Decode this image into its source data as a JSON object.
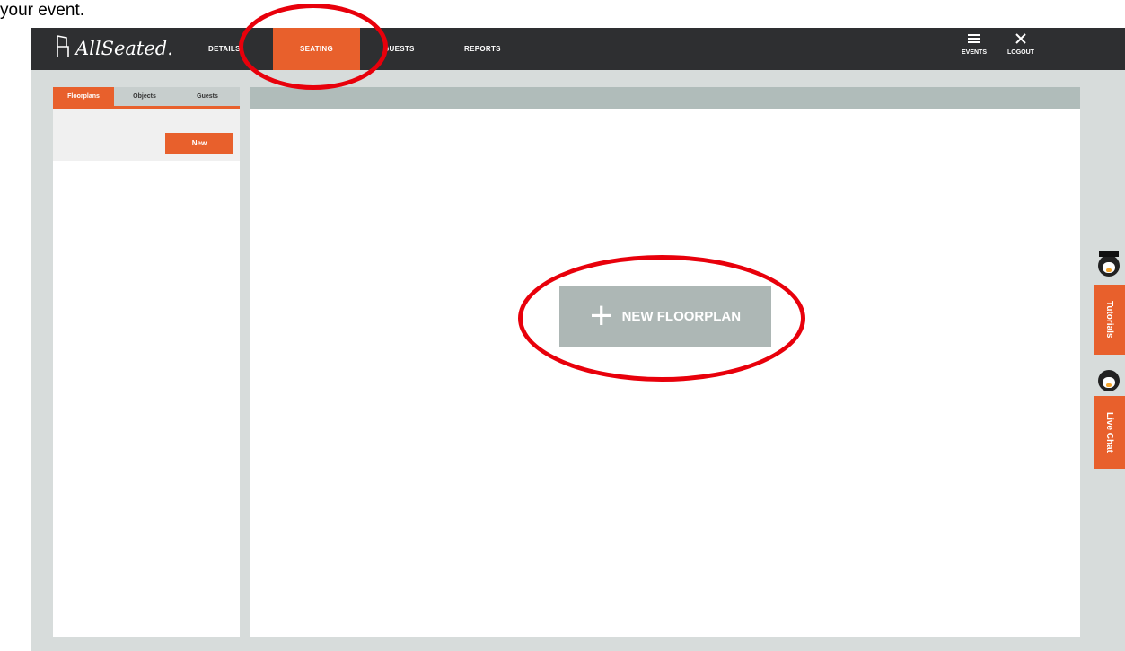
{
  "caption": "your event.",
  "app": {
    "logo_text": "AllSeated."
  },
  "topnav": {
    "items": [
      {
        "label": "DETAILS"
      },
      {
        "label": "SEATING"
      },
      {
        "label": "GUESTS"
      },
      {
        "label": "REPORTS"
      }
    ],
    "active": "SEATING",
    "events_label": "EVENTS",
    "logout_label": "LOGOUT",
    "events_icon": "menu-icon",
    "logout_icon": "close-icon"
  },
  "left_panel": {
    "tabs": [
      {
        "label": "Floorplans"
      },
      {
        "label": "Objects"
      },
      {
        "label": "Guests"
      }
    ],
    "active_tab": "Floorplans",
    "new_button": "New"
  },
  "main": {
    "new_floorplan_label": "NEW FLOORPLAN",
    "new_floorplan_icon": "plus-icon"
  },
  "side_tabs": {
    "tutorials": "Tutorials",
    "live_chat": "Live Chat"
  },
  "colors": {
    "accent": "#e8602c",
    "topbar": "#2e2f31",
    "annotation": "#e8000b"
  }
}
